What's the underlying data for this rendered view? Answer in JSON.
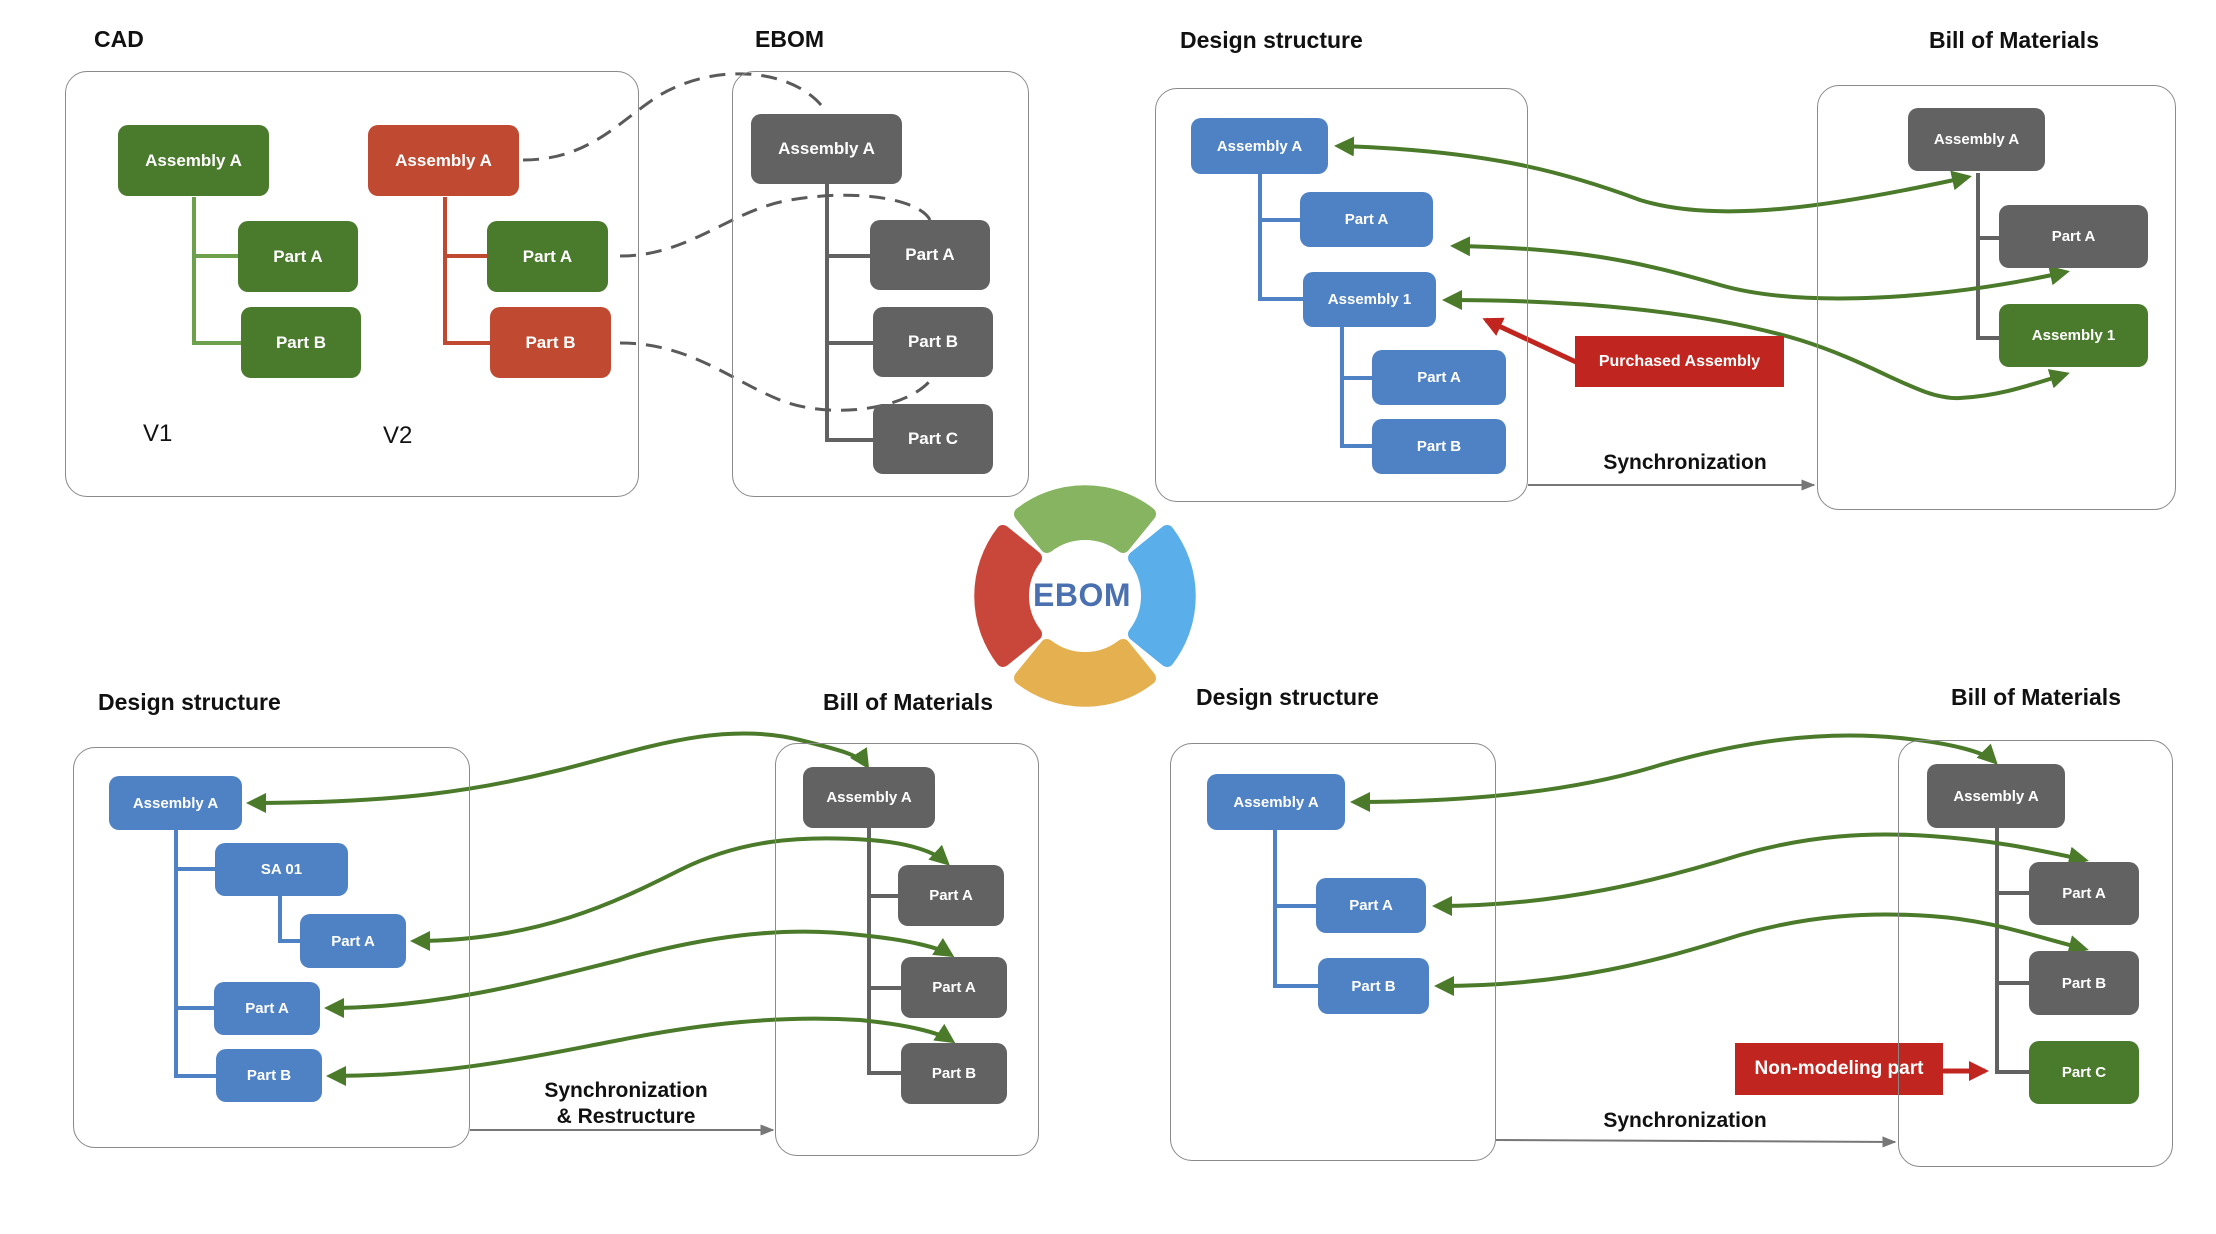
{
  "colors": {
    "cad_green": "#4a7a2c",
    "cad_changed_red": "#c04a31",
    "design_blue": "#4f82c4",
    "bom_gray": "#626262",
    "note_red": "#c0261f",
    "arrow_green": "#4a7a2a",
    "dashed_gray": "#5a5a5a",
    "logo_green": "#86b461",
    "logo_blue": "#5aaee9",
    "logo_orange": "#e5b150",
    "logo_red": "#c9473a",
    "logo_text": "#4a70b0"
  },
  "center_logo": {
    "label": "EBOM",
    "icon": "ebom-cycle-icon"
  },
  "panel_cad_ebom": {
    "cad_title": "CAD",
    "ebom_title": "EBOM",
    "v1": {
      "label": "V1",
      "assembly": "Assembly A",
      "parts": [
        "Part A",
        "Part B"
      ]
    },
    "v2": {
      "label": "V2",
      "assembly": "Assembly A",
      "parts": [
        "Part A",
        "Part B"
      ]
    },
    "ebom": {
      "assembly": "Assembly A",
      "parts": [
        "Part A",
        "Part B",
        "Part C"
      ]
    }
  },
  "panel_purchased": {
    "design_title": "Design structure",
    "bom_title": "Bill of Materials",
    "design": {
      "assembly": "Assembly A",
      "part_a": "Part A",
      "sub_assembly": "Assembly 1",
      "sub_parts": [
        "Part A",
        "Part B"
      ]
    },
    "bom": {
      "assembly": "Assembly A",
      "part_a": "Part A",
      "sub_assembly": "Assembly 1"
    },
    "note": "Purchased Assembly",
    "sync_label": "Synchronization"
  },
  "panel_restructure": {
    "design_title": "Design structure",
    "bom_title": "Bill of Materials",
    "design": {
      "assembly": "Assembly A",
      "sub_assembly": "SA 01",
      "sub_part": "Part A",
      "parts": [
        "Part A",
        "Part B"
      ]
    },
    "bom": {
      "assembly": "Assembly A",
      "parts": [
        "Part A",
        "Part A",
        "Part B"
      ]
    },
    "sync_label_line1": "Synchronization",
    "sync_label_line2": "& Restructure"
  },
  "panel_nonmodeling": {
    "design_title": "Design structure",
    "bom_title": "Bill of Materials",
    "design": {
      "assembly": "Assembly A",
      "parts": [
        "Part A",
        "Part B"
      ]
    },
    "bom": {
      "assembly": "Assembly A",
      "parts": [
        "Part A",
        "Part B",
        "Part C"
      ]
    },
    "note": "Non-modeling part",
    "sync_label": "Synchronization"
  }
}
